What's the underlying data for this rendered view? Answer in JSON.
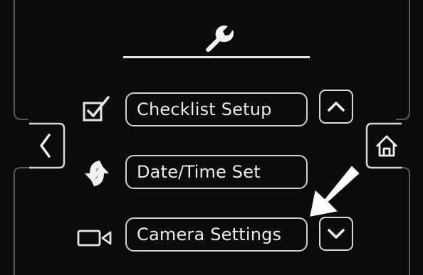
{
  "header": {
    "icon": "wrench-icon"
  },
  "menu": {
    "items": [
      {
        "label": "Checklist Setup",
        "icon": "checkbox-icon"
      },
      {
        "label": "Date/Time Set",
        "icon": "sync-arrows-icon"
      },
      {
        "label": "Camera Settings",
        "icon": "camera-icon"
      }
    ]
  },
  "nav": {
    "back_icon": "chevron-left-icon",
    "home_icon": "home-icon",
    "scroll_up_icon": "chevron-up-icon",
    "scroll_down_icon": "chevron-down-icon"
  },
  "annotation": {
    "icon": "pointer-arrow-icon"
  },
  "colors": {
    "background": "#0b0b0b",
    "outline": "#d0d0d0",
    "text": "#ececec"
  }
}
